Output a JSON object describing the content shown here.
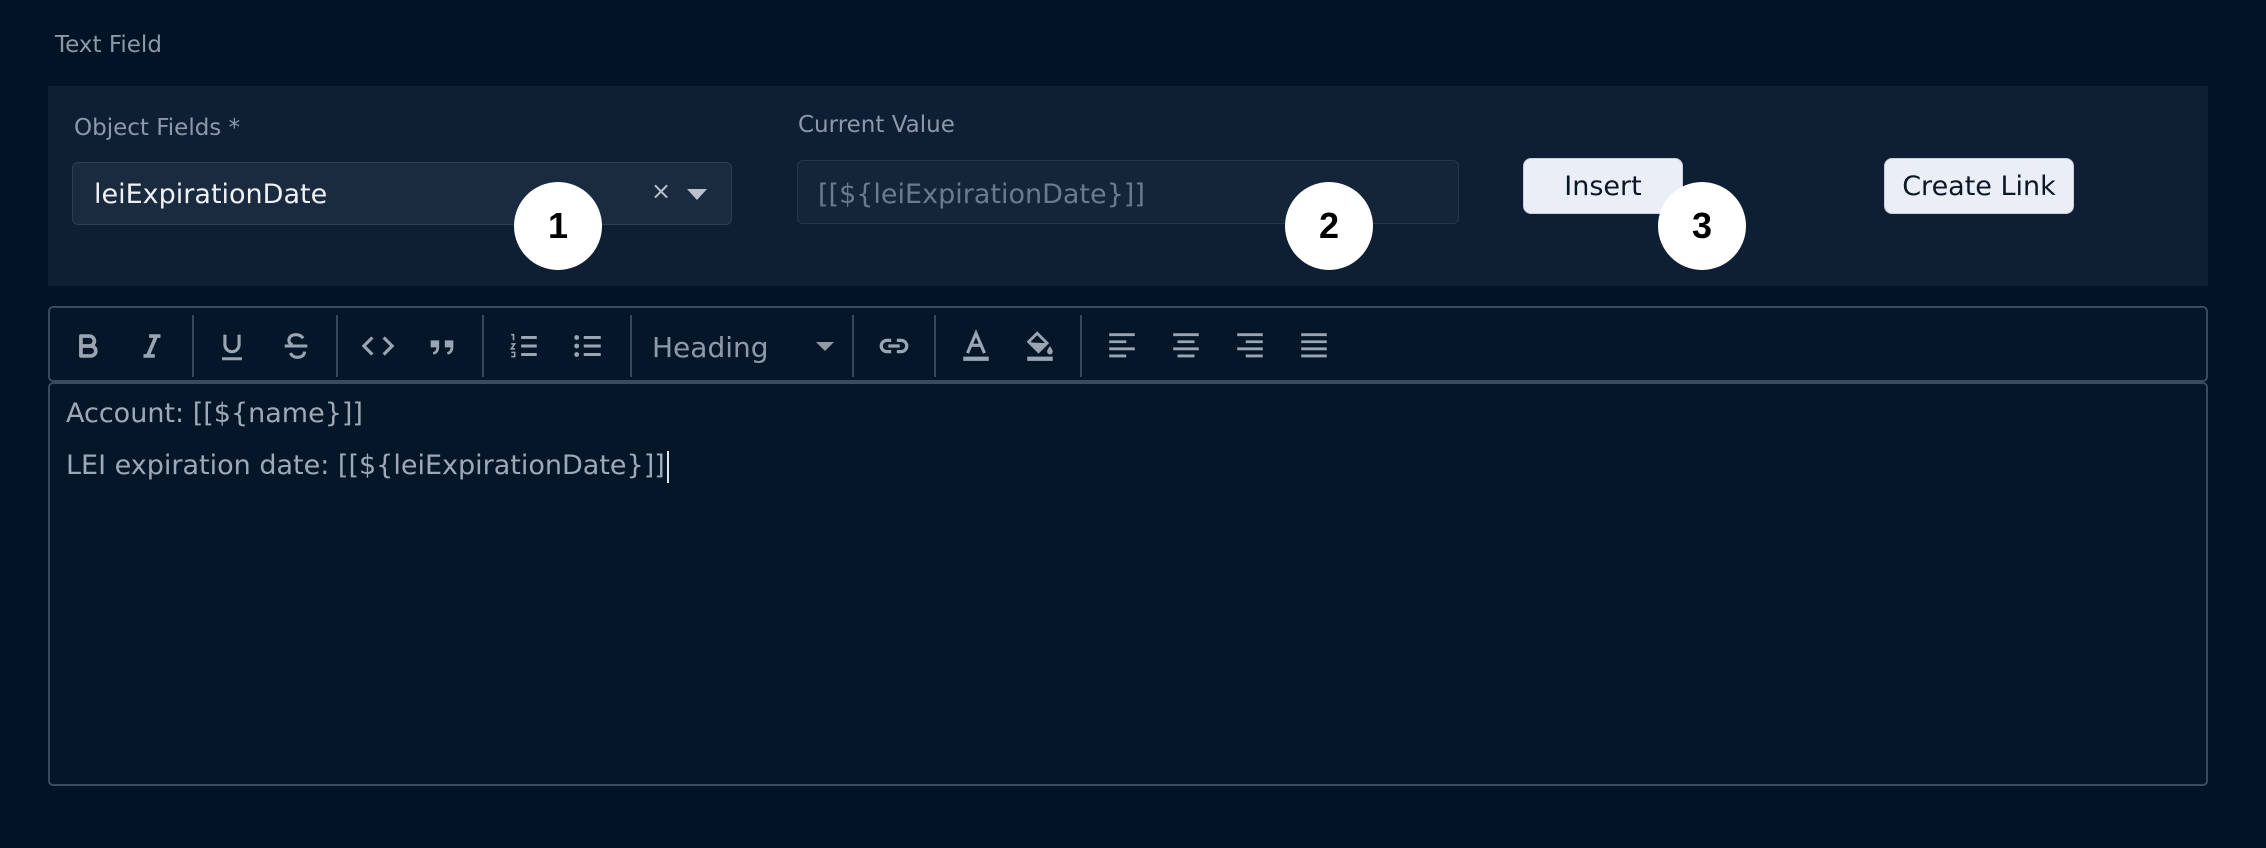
{
  "section": {
    "label": "Text Field"
  },
  "object_fields": {
    "label": "Object Fields *",
    "selected": "leiExpirationDate",
    "clear_glyph": "×",
    "caret_icon": "chevron-down-icon"
  },
  "current_value": {
    "label": "Current Value",
    "value": "[[${leiExpirationDate}]]"
  },
  "buttons": {
    "insert": "Insert",
    "create_link": "Create Link"
  },
  "badges": [
    "1",
    "2",
    "3"
  ],
  "toolbar": {
    "heading_label": "Heading",
    "icons": [
      "bold-icon",
      "italic-icon",
      "underline-icon",
      "strikethrough-icon",
      "code-icon",
      "blockquote-icon",
      "ordered-list-icon",
      "bullet-list-icon",
      "link-icon",
      "text-color-icon",
      "highlight-color-icon",
      "align-left-icon",
      "align-center-icon",
      "align-right-icon",
      "align-justify-icon"
    ]
  },
  "editor": {
    "lines": [
      "Account: [[${name}]]",
      "LEI expiration date: [[${leiExpirationDate}]]"
    ]
  },
  "colors": {
    "background": "#021326",
    "panel": "#0e1f33",
    "button_bg": "#eaeef7",
    "badge_bg": "#ffffff",
    "icon": "#9aa5b4"
  }
}
